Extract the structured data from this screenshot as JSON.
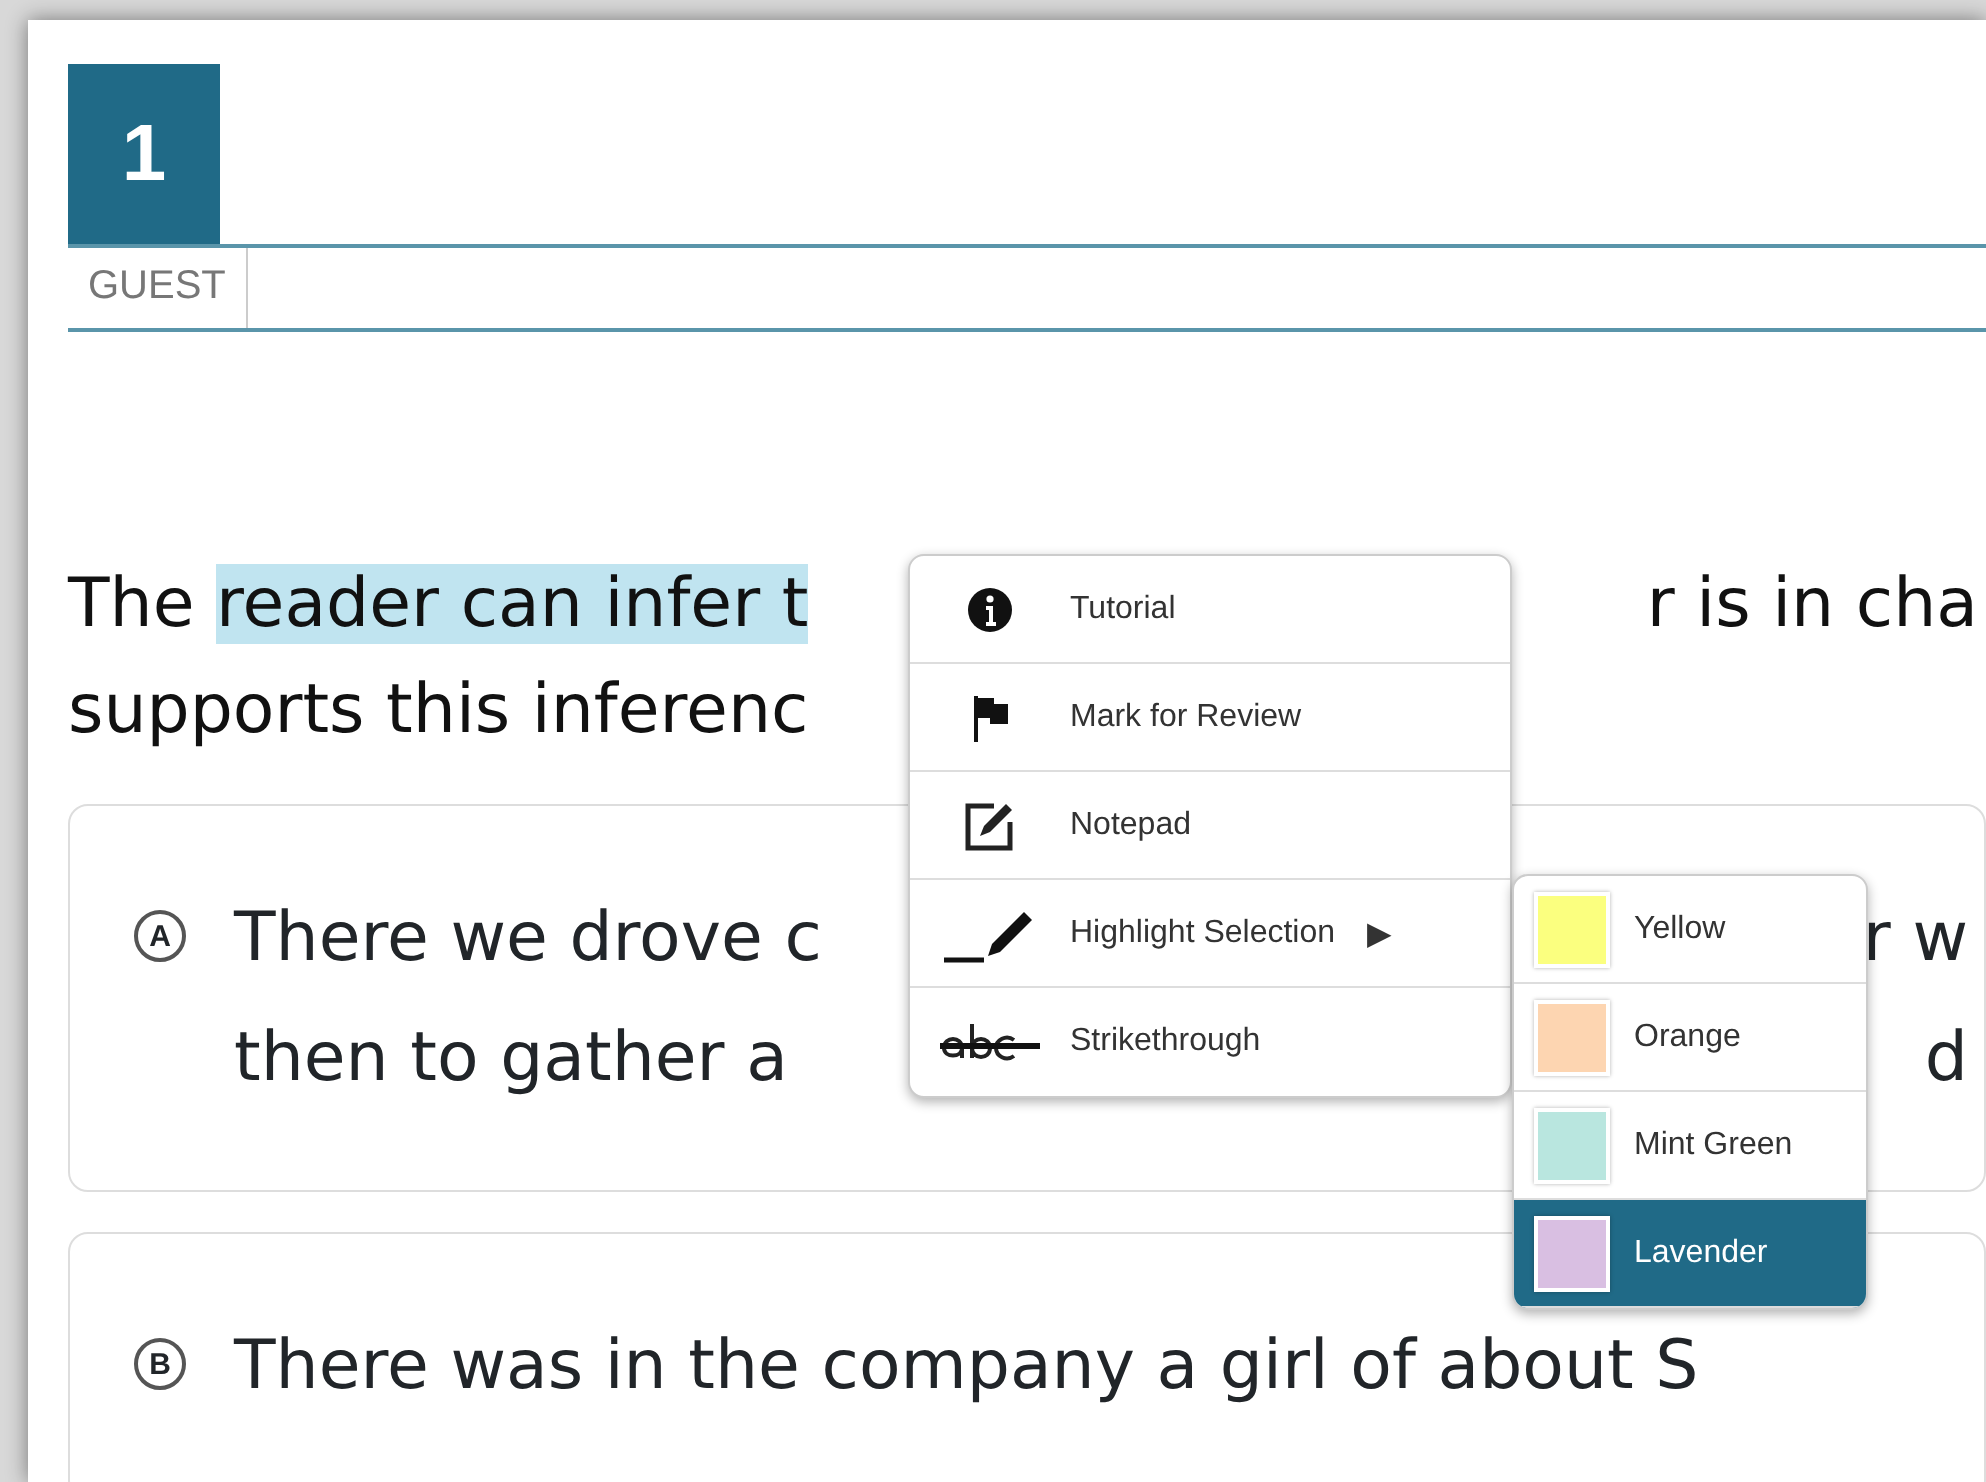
{
  "question_number": "1",
  "user_label": "GUEST",
  "question": {
    "lines": [
      {
        "segments": [
          {
            "text": "The ",
            "highlighted": false
          },
          {
            "text": "reader can infer t",
            "highlighted": true
          }
        ],
        "right": "r is in cha"
      },
      {
        "segments": [
          {
            "text": "supports this inferenc",
            "highlighted": false
          }
        ]
      }
    ]
  },
  "options": [
    {
      "letter": "A",
      "lines": [
        {
          "left": "There we drove c",
          "right": "r w"
        },
        {
          "left": "then to gather a",
          "right": "d"
        }
      ]
    },
    {
      "letter": "B",
      "lines": [
        {
          "left": "There was in the company a girl of about S"
        }
      ]
    }
  ],
  "context_menu": {
    "items": [
      {
        "kind": "info",
        "label": "Tutorial"
      },
      {
        "kind": "flag",
        "label": "Mark for Review"
      },
      {
        "kind": "notepad",
        "label": "Notepad"
      },
      {
        "kind": "highlight",
        "label": "Highlight Selection",
        "arrow": "▶"
      },
      {
        "kind": "strike",
        "label": "Strikethrough"
      }
    ]
  },
  "color_menu": {
    "items": [
      {
        "label": "Yellow",
        "color": "#fbff7f",
        "selected": false
      },
      {
        "label": "Orange",
        "color": "#fdd5b1",
        "selected": false
      },
      {
        "label": "Mint Green",
        "color": "#b9e6df",
        "selected": false
      },
      {
        "label": "Lavender",
        "color": "#d9bfe2",
        "selected": true
      }
    ]
  }
}
